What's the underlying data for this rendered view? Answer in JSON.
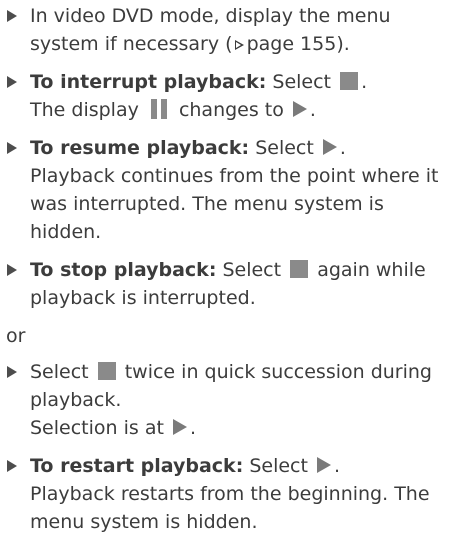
{
  "steps": [
    {
      "lines": [
        "In video DVD mode, display the menu",
        "system if necessary (",
        "page 155)."
      ]
    },
    {
      "bold": "To interrupt playback:",
      "text1": "Select",
      "text1_end": ".",
      "line2_a": "The display",
      "line2_b": "changes to",
      "line2_end": "."
    },
    {
      "bold": "To resume playback:",
      "text1": "Select",
      "text1_end": ".",
      "lines": [
        "Playback continues from the point where it",
        "was interrupted. The menu system is",
        "hidden."
      ]
    },
    {
      "bold": "To stop playback:",
      "text1": "Select",
      "text1_b": "again while",
      "line2": "playback is interrupted."
    },
    {
      "or": "or"
    },
    {
      "text1": "Select",
      "text1_b": "twice in quick succession during",
      "line2": "playback.",
      "line3_a": "Selection is at",
      "line3_end": "."
    },
    {
      "bold": "To restart playback:",
      "text1": "Select",
      "text1_end": ".",
      "lines": [
        "Playback restarts from the beginning. The",
        "menu system is hidden."
      ]
    }
  ],
  "icons": {
    "bullet": "bullet-triangle-icon",
    "stop": "stop-square-icon",
    "pause": "pause-icon",
    "play": "play-icon",
    "reference": "page-reference-arrow-icon"
  }
}
